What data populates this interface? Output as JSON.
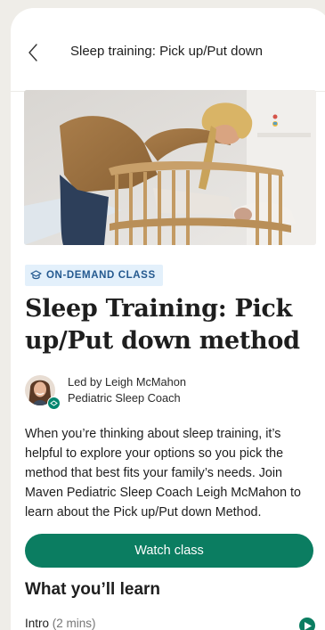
{
  "header": {
    "title": "Sleep training: Pick up/Put down",
    "back_icon": "chevron-left-icon"
  },
  "badge": {
    "icon": "graduation-cap-icon",
    "label": "ON-DEMAND CLASS"
  },
  "class": {
    "title": "Sleep Training: Pick up/Put down method",
    "coach_line1": "Led by Leigh McMahon",
    "coach_line2": "Pediatric Sleep Coach",
    "description": "When you’re thinking about sleep training, it’s helpful to explore your options so you pick the method that best fits your family’s needs. Join Maven Pediatric Sleep Coach Leigh McMahon to learn about the Pick up/Put down Method."
  },
  "actions": {
    "watch_label": "Watch class"
  },
  "learn": {
    "heading": "What you’ll learn",
    "lessons": [
      {
        "name": "Intro",
        "duration": "(2 mins)"
      }
    ]
  },
  "colors": {
    "accent": "#0b7d61",
    "badge_bg": "#e3f0fb",
    "badge_text": "#24598f",
    "page_bg": "#efede8"
  }
}
